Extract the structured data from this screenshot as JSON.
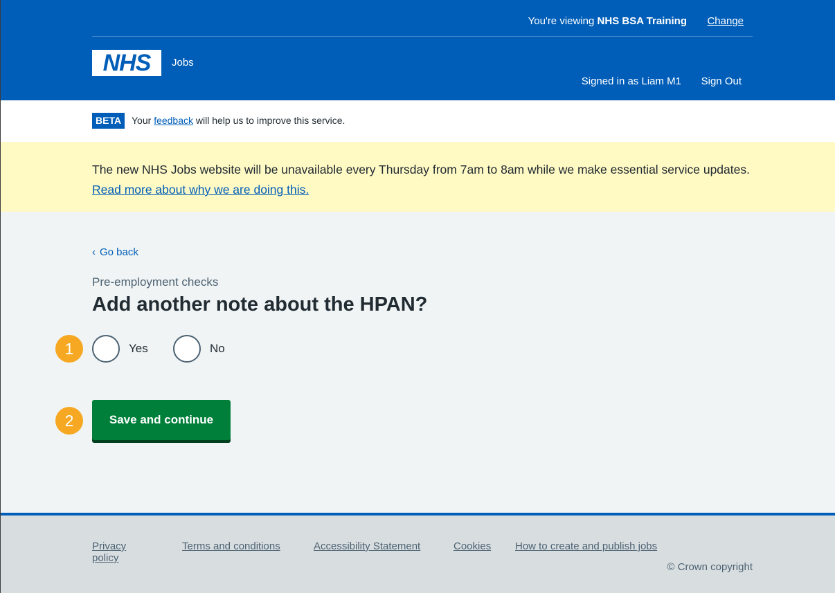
{
  "header": {
    "org_prefix": "You're viewing",
    "org_name": "NHS BSA Training",
    "change_label": "Change",
    "logo_text": "NHS",
    "service_name": "Jobs",
    "signed_in_text": "Signed in as Liam M1",
    "sign_out_label": "Sign Out",
    "brand_color": "#005eb8"
  },
  "beta": {
    "tag": "BETA",
    "text_before": "Your",
    "link": "feedback",
    "text_after": "will help us to improve this service."
  },
  "notice": {
    "text": "The new NHS Jobs website will be unavailable every Thursday from 7am to 8am while we make essential service updates.",
    "link": "Read more about why we are doing this."
  },
  "main": {
    "back_label": "Go back",
    "caption": "Pre-employment checks",
    "heading": "Add another note about the HPAN?",
    "radio_options": [
      "Yes",
      "No"
    ],
    "save_label": "Save and continue",
    "markers": [
      "1",
      "2"
    ],
    "save_color": "#007f3b",
    "marker_color": "#f7a823"
  },
  "footer": {
    "links": [
      "Privacy policy",
      "Terms and conditions",
      "Accessibility Statement",
      "Cookies",
      "How to create and publish jobs"
    ],
    "copyright": "© Crown copyright"
  }
}
